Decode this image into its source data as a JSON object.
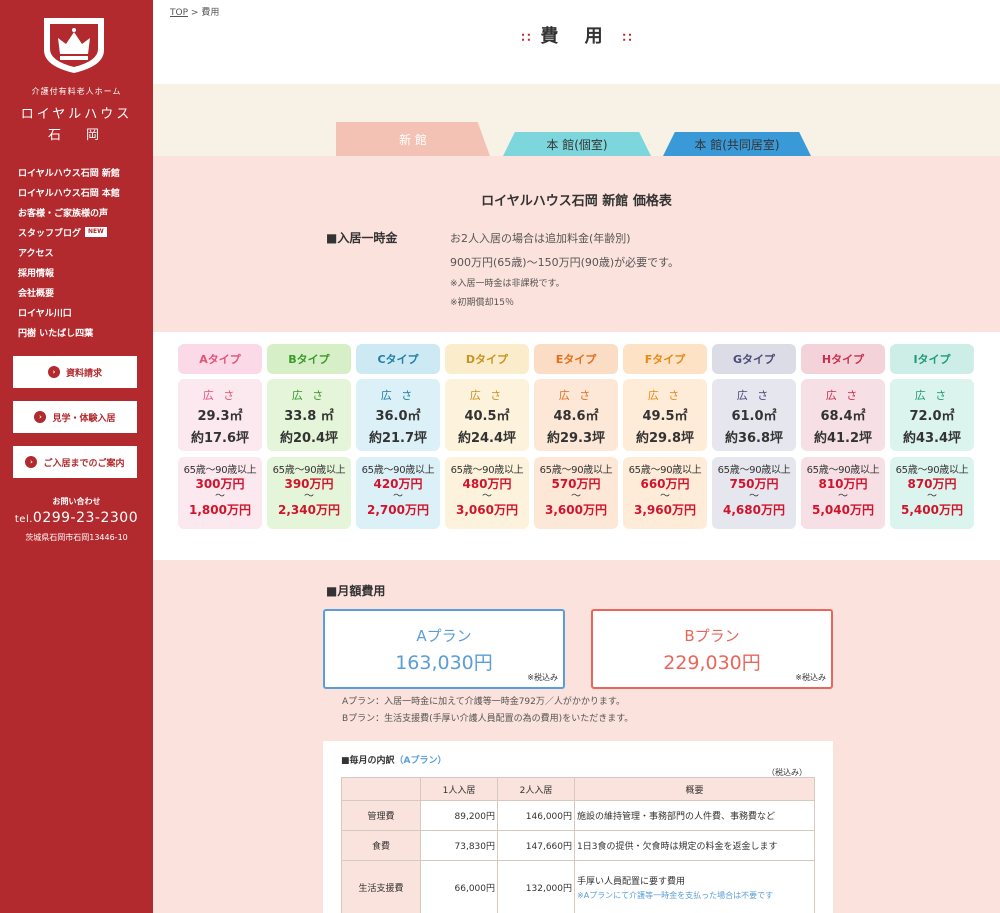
{
  "sidebar": {
    "brand_small": "介護付有料老人ホーム",
    "brand_name": "ロイヤルハウス",
    "brand_location": "石　岡",
    "nav": [
      {
        "label": "ロイヤルハウス石岡 新館"
      },
      {
        "label": "ロイヤルハウス石岡 本館"
      },
      {
        "label": "お客様・ご家族様の声"
      },
      {
        "label": "スタッフブログ",
        "badge": "NEW"
      },
      {
        "label": "アクセス"
      },
      {
        "label": "採用情報"
      },
      {
        "label": "会社概要"
      },
      {
        "label": "ロイヤル川口"
      },
      {
        "label": "円樹 いたばし四葉"
      }
    ],
    "buttons": {
      "request": "資料請求",
      "visit": "見学・体験入居",
      "guide": "ご入居までのご案内",
      "arrow_icon": "›"
    },
    "contact_label": "お問い合わせ",
    "tel_prefix": "tel.",
    "tel_number": "0299-23-2300",
    "address": "茨城県石岡市石岡13446-10"
  },
  "breadcrumb": {
    "top": "TOP",
    "sep": ">",
    "current": "費用"
  },
  "page_title": "費 用",
  "title_deco": "∷",
  "tabs": {
    "shinkan": "新 館",
    "kojin": "本 館(個室)",
    "kyodo": "本 館(共同居室)"
  },
  "price_table_title": "ロイヤルハウス石岡 新館 価格表",
  "ikkatsu": {
    "heading": "■入居一時金",
    "note1": "お2人入居の場合は追加料金(年齢別)",
    "note2": "900万円(65歳)〜150万円(90歳)が必要です。",
    "note3": "※入居一時金は非課税です。",
    "note4": "※初期償却15％"
  },
  "room_types": {
    "area_label": "広 さ",
    "age_label": "65歳〜90歳以上",
    "tilde": "〜",
    "items": [
      {
        "name": "Aタイプ",
        "sqm": "29.3㎡",
        "tsubo": "約17.6坪",
        "price_min": "300万円",
        "price_max": "1,800万円",
        "head_bg": "#fbd9e6",
        "body_bg": "#fce8ef",
        "text": "#e0557a"
      },
      {
        "name": "Bタイプ",
        "sqm": "33.8 ㎡",
        "tsubo": "約20.4坪",
        "price_min": "390万円",
        "price_max": "2,340万円",
        "head_bg": "#d7efc6",
        "body_bg": "#e5f5d9",
        "text": "#3a9a2a"
      },
      {
        "name": "Cタイプ",
        "sqm": "36.0㎡",
        "tsubo": "約21.7坪",
        "price_min": "420万円",
        "price_max": "2,700万円",
        "head_bg": "#cde9f3",
        "body_bg": "#dcf0f7",
        "text": "#1f7fa8"
      },
      {
        "name": "Dタイプ",
        "sqm": "40.5㎡",
        "tsubo": "約24.4坪",
        "price_min": "480万円",
        "price_max": "3,060万円",
        "head_bg": "#fbeccb",
        "body_bg": "#fdf3dc",
        "text": "#c99320"
      },
      {
        "name": "Eタイプ",
        "sqm": "48.6㎡",
        "tsubo": "約29.3坪",
        "price_min": "570万円",
        "price_max": "3,600万円",
        "head_bg": "#fbdcc5",
        "body_bg": "#fde8d8",
        "text": "#e0701f"
      },
      {
        "name": "Fタイプ",
        "sqm": "49.5㎡",
        "tsubo": "約29.8坪",
        "price_min": "660万円",
        "price_max": "3,960万円",
        "head_bg": "#fde2c6",
        "body_bg": "#feecd9",
        "text": "#e38a1a"
      },
      {
        "name": "Gタイプ",
        "sqm": "61.0㎡",
        "tsubo": "約36.8坪",
        "price_min": "750万円",
        "price_max": "4,680万円",
        "head_bg": "#dcdce6",
        "body_bg": "#e6e6ee",
        "text": "#4a4a7a"
      },
      {
        "name": "Hタイプ",
        "sqm": "68.4㎡",
        "tsubo": "約41.2坪",
        "price_min": "810万円",
        "price_max": "5,040万円",
        "head_bg": "#f3d2d9",
        "body_bg": "#f7e0e5",
        "text": "#c9324d"
      },
      {
        "name": "Iタイプ",
        "sqm": "72.0㎡",
        "tsubo": "約43.4坪",
        "price_min": "870万円",
        "price_max": "5,400万円",
        "head_bg": "#cdeee6",
        "body_bg": "#dcf4ee",
        "text": "#1f9a7a"
      }
    ]
  },
  "getsugaku": {
    "heading": "■月額費用",
    "plan_a": {
      "name": "Aプラン",
      "price": "163,030円",
      "tax": "※税込み"
    },
    "plan_b": {
      "name": "Bプラン",
      "price": "229,030円",
      "tax": "※税込み"
    },
    "note_a": "Aプラン：入居一時金に加えて介護等一時金792万／人がかかります。",
    "note_b": "Bプラン：生活支援費(手厚い介護人員配置の為の費用)をいただきます。"
  },
  "breakdown": {
    "title": "■毎月の内訳",
    "plan_label": "（Aプラン）",
    "tax_label": "（税込み）",
    "headers": [
      "",
      "1人入居",
      "2人入居",
      "概要"
    ],
    "rows": [
      {
        "label": "管理費",
        "single": "89,200円",
        "double": "146,000円",
        "desc": "施設の維持管理・事務部門の人件費、事務費など",
        "sub": ""
      },
      {
        "label": "食費",
        "single": "73,830円",
        "double": "147,660円",
        "desc": "1日3食の提供・欠食時は規定の料金を返金します",
        "sub": ""
      },
      {
        "label": "生活支援費",
        "single": "66,000円",
        "double": "132,000円",
        "desc": "手厚い人員配置に要す費用",
        "sub": "※Aプランにて介護等一時金を支払った場合は不要です"
      }
    ]
  }
}
